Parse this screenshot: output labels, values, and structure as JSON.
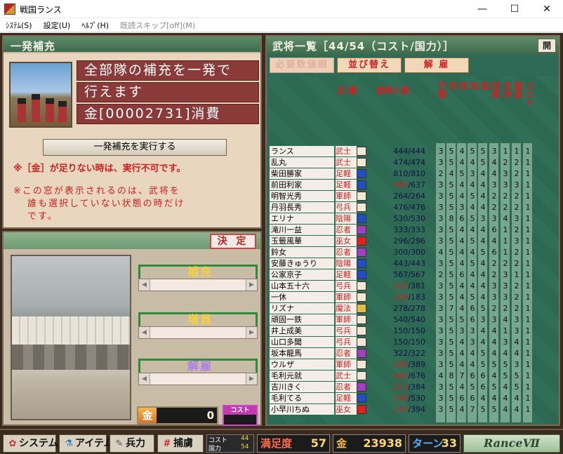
{
  "window": {
    "title": "戦国ランス",
    "minimize": "—",
    "maximize": "☐",
    "close": "✕"
  },
  "menu": {
    "items": [
      {
        "label": "ｼｽﾃﾑ(S)",
        "disabled": false
      },
      {
        "label": "設定(U)",
        "disabled": false
      },
      {
        "label": "ﾍﾙﾌﾟ(H)",
        "disabled": false
      },
      {
        "label": "既読スキップ[off](M)",
        "disabled": true
      }
    ]
  },
  "refill_panel": {
    "title": "一発補充",
    "lines": [
      "全部隊の補充を一発で",
      "行えます",
      "金[00002731]消費"
    ],
    "execute_label": "一発補充を実行する",
    "warning1": "※［金］が足りない時は、実行不可です。",
    "warning2": [
      "※この窓が表示されるのは、武将を",
      "誰も選択していない状態の時だけ",
      "です。"
    ]
  },
  "adjust_panel": {
    "decide_label": "決 定",
    "groups": [
      {
        "label": "補充",
        "color": "#f4d040"
      },
      {
        "label": "増員",
        "color": "#f4d040"
      },
      {
        "label": "解雇",
        "color": "#b080e0"
      }
    ],
    "gold_label": "金",
    "gold_value": "0",
    "cost_label": "コスト"
  },
  "roster": {
    "title": "武将一覧［44/54（コスト/国力）］",
    "open_label": "開",
    "buttons": {
      "required": "必要数値順",
      "sort": "並び替え",
      "dismiss": "解 雇"
    },
    "headers": {
      "type": "兵 種",
      "troops": "部隊人数",
      "stats": [
        "行動",
        "攻",
        "防",
        "知",
        "速",
        "採索",
        "交渉",
        "建設",
        "コスト"
      ]
    },
    "rows": [
      {
        "name": "ランス",
        "type": "武士",
        "icon_color": "#f0e8d0",
        "cur": "444",
        "max": "444",
        "low": false,
        "stats": [
          "3",
          "5",
          "4",
          "5",
          "5",
          "3",
          "1",
          "1",
          "1"
        ]
      },
      {
        "name": "乱丸",
        "type": "武士",
        "icon_color": "#f0e8d0",
        "cur": "474",
        "max": "474",
        "low": false,
        "stats": [
          "3",
          "5",
          "4",
          "4",
          "5",
          "4",
          "2",
          "2",
          "1"
        ]
      },
      {
        "name": "柴田勝家",
        "type": "足軽",
        "icon_color": "#2050c0",
        "cur": "810",
        "max": "810",
        "low": false,
        "stats": [
          "2",
          "4",
          "5",
          "3",
          "4",
          "4",
          "3",
          "2",
          "1"
        ]
      },
      {
        "name": "前田利家",
        "type": "足軽",
        "icon_color": "#2050c0",
        "cur": "600",
        "max": "637",
        "low": true,
        "stats": [
          "3",
          "5",
          "4",
          "4",
          "4",
          "3",
          "3",
          "3",
          "1"
        ]
      },
      {
        "name": "明智光秀",
        "type": "軍師",
        "icon_color": "#f0e8d0",
        "cur": "264",
        "max": "264",
        "low": false,
        "stats": [
          "3",
          "5",
          "4",
          "5",
          "4",
          "2",
          "2",
          "2",
          "1"
        ]
      },
      {
        "name": "丹羽長秀",
        "type": "弓兵",
        "icon_color": "#f0e8d0",
        "cur": "476",
        "max": "476",
        "low": false,
        "stats": [
          "3",
          "5",
          "3",
          "4",
          "4",
          "2",
          "2",
          "2",
          "1"
        ]
      },
      {
        "name": "エリナ",
        "type": "陰陽",
        "icon_color": "#2050c0",
        "cur": "530",
        "max": "530",
        "low": false,
        "stats": [
          "3",
          "8",
          "6",
          "5",
          "3",
          "3",
          "4",
          "3",
          "1"
        ]
      },
      {
        "name": "滝川一益",
        "type": "忍者",
        "icon_color": "#a040c0",
        "cur": "333",
        "max": "333",
        "low": false,
        "stats": [
          "3",
          "5",
          "4",
          "4",
          "4",
          "6",
          "1",
          "2",
          "1"
        ]
      },
      {
        "name": "玉籤風華",
        "type": "巫女",
        "icon_color": "#e02020",
        "cur": "296",
        "max": "296",
        "low": false,
        "stats": [
          "3",
          "5",
          "4",
          "5",
          "4",
          "4",
          "1",
          "3",
          "1"
        ]
      },
      {
        "name": "鈴女",
        "type": "忍者",
        "icon_color": "#a040c0",
        "cur": "300",
        "max": "300",
        "low": false,
        "stats": [
          "4",
          "5",
          "4",
          "4",
          "5",
          "6",
          "1",
          "2",
          "1"
        ]
      },
      {
        "name": "安藤きゅうり",
        "type": "陰陽",
        "icon_color": "#2050c0",
        "cur": "443",
        "max": "443",
        "low": false,
        "stats": [
          "3",
          "5",
          "4",
          "5",
          "4",
          "2",
          "2",
          "2",
          "1"
        ]
      },
      {
        "name": "公家京子",
        "type": "足軽",
        "icon_color": "#2050c0",
        "cur": "567",
        "max": "567",
        "low": false,
        "stats": [
          "2",
          "5",
          "6",
          "4",
          "4",
          "2",
          "3",
          "1",
          "1"
        ]
      },
      {
        "name": "山本五十六",
        "type": "弓兵",
        "icon_color": "#f0e8d0",
        "cur": "351",
        "max": "381",
        "low": true,
        "stats": [
          "3",
          "5",
          "4",
          "4",
          "4",
          "3",
          "3",
          "2",
          "1"
        ]
      },
      {
        "name": "一休",
        "type": "軍師",
        "icon_color": "#f0e8d0",
        "cur": "109",
        "max": "183",
        "low": true,
        "stats": [
          "3",
          "5",
          "4",
          "5",
          "4",
          "3",
          "3",
          "2",
          "1"
        ]
      },
      {
        "name": "リズナ",
        "type": "魔法",
        "icon_color": "#e0c040",
        "cur": "278",
        "max": "278",
        "low": false,
        "stats": [
          "3",
          "7",
          "4",
          "6",
          "5",
          "2",
          "2",
          "2",
          "1"
        ]
      },
      {
        "name": "頑固一鉄",
        "type": "軍師",
        "icon_color": "#f0e8d0",
        "cur": "540",
        "max": "540",
        "low": false,
        "stats": [
          "3",
          "5",
          "5",
          "6",
          "3",
          "3",
          "4",
          "3",
          "1"
        ]
      },
      {
        "name": "井上成美",
        "type": "弓兵",
        "icon_color": "#f0e8d0",
        "cur": "150",
        "max": "150",
        "low": false,
        "stats": [
          "3",
          "5",
          "3",
          "3",
          "4",
          "4",
          "1",
          "3",
          "1"
        ]
      },
      {
        "name": "山口多聞",
        "type": "弓兵",
        "icon_color": "#f0e8d0",
        "cur": "150",
        "max": "150",
        "low": false,
        "stats": [
          "3",
          "5",
          "4",
          "3",
          "4",
          "4",
          "3",
          "4",
          "1"
        ]
      },
      {
        "name": "坂本龍馬",
        "type": "忍者",
        "icon_color": "#a040c0",
        "cur": "322",
        "max": "322",
        "low": false,
        "stats": [
          "3",
          "5",
          "4",
          "4",
          "5",
          "4",
          "4",
          "4",
          "1"
        ]
      },
      {
        "name": "ウルザ",
        "type": "軍師",
        "icon_color": "#f0e8d0",
        "cur": "340",
        "max": "389",
        "low": true,
        "stats": [
          "3",
          "5",
          "4",
          "4",
          "5",
          "5",
          "5",
          "3",
          "1"
        ]
      },
      {
        "name": "毛利元就",
        "type": "武士",
        "icon_color": "#f0e8d0",
        "cur": "666",
        "max": "676",
        "low": true,
        "stats": [
          "4",
          "8",
          "7",
          "6",
          "6",
          "4",
          "5",
          "5",
          "1"
        ]
      },
      {
        "name": "吉川きく",
        "type": "忍者",
        "icon_color": "#a040c0",
        "cur": "213",
        "max": "384",
        "low": true,
        "stats": [
          "3",
          "5",
          "4",
          "5",
          "6",
          "5",
          "4",
          "5",
          "1"
        ]
      },
      {
        "name": "毛利てる",
        "type": "足軽",
        "icon_color": "#2050c0",
        "cur": "168",
        "max": "530",
        "low": true,
        "stats": [
          "3",
          "5",
          "6",
          "6",
          "4",
          "4",
          "4",
          "4",
          "1"
        ]
      },
      {
        "name": "小早川ちぬ",
        "type": "巫女",
        "icon_color": "#e02020",
        "cur": "145",
        "max": "394",
        "low": true,
        "stats": [
          "3",
          "5",
          "4",
          "7",
          "5",
          "5",
          "4",
          "4",
          "1"
        ]
      }
    ]
  },
  "bottom": {
    "system_label": "システム",
    "item_label": "アイテム",
    "troops_label": "兵力",
    "capture_label": "捕虜",
    "cost_label": "コスト",
    "cost_value": "44",
    "power_label": "国力",
    "power_value": "54",
    "satisfaction_label": "満足度",
    "satisfaction_value": "57",
    "gold_label": "金",
    "gold_value": "23938",
    "turn_label": "ターン",
    "turn_value": "33",
    "logo": "RanceⅦ"
  }
}
